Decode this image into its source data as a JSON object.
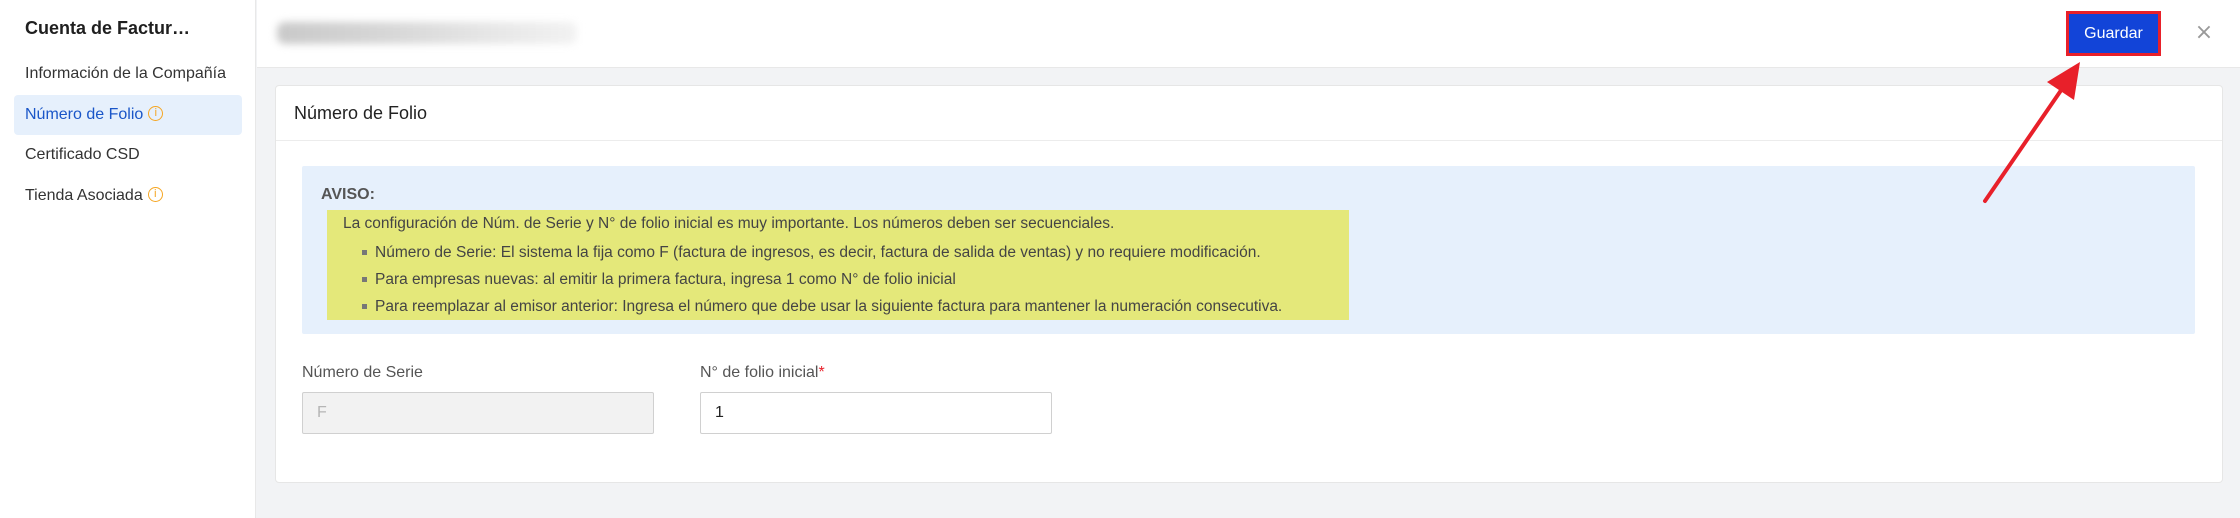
{
  "sidebar": {
    "title": "Cuenta de Factur…",
    "items": [
      {
        "label": "Información de la Compañía",
        "info": false
      },
      {
        "label": "Número de Folio",
        "info": true,
        "active": true
      },
      {
        "label": "Certificado CSD",
        "info": false
      },
      {
        "label": "Tienda Asociada",
        "info": true
      }
    ]
  },
  "header": {
    "save_label": "Guardar",
    "close_glyph": "×"
  },
  "card": {
    "title": "Número de Folio",
    "notice": {
      "title": "AVISO:",
      "main": "La configuración de Núm. de Serie y N° de folio inicial es muy importante. Los números deben ser secuenciales.",
      "bullets": [
        "Número de Serie: El sistema la fija como F (factura de ingresos, es decir, factura de salida de ventas) y no requiere modificación.",
        "Para empresas nuevas: al emitir la primera factura, ingresa 1 como N° de folio inicial",
        "Para reemplazar al emisor anterior: Ingresa el número que debe usar la siguiente factura para mantener la numeración consecutiva."
      ]
    },
    "fields": {
      "serie_label": "Número de Serie",
      "serie_value": "F",
      "folio_label": "N° de folio inicial",
      "folio_required_mark": "*",
      "folio_value": "1"
    }
  },
  "icons": {
    "info": "info-circle-icon",
    "close": "close-icon",
    "annotation": "red-arrow-annotation"
  },
  "colors": {
    "accent": "#1244d8",
    "highlight": "#e4e87a",
    "notice_bg": "#e6f0fc",
    "annotation": "#e8202a"
  }
}
